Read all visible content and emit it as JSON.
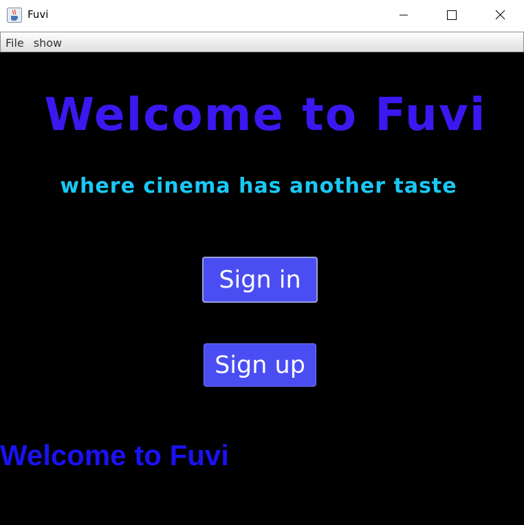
{
  "window": {
    "title": "Fuvi",
    "icons": {
      "app": "java-cup-icon",
      "minimize": "minimize-icon",
      "maximize": "maximize-icon",
      "close": "close-icon"
    }
  },
  "menubar": {
    "items": [
      {
        "label": "File"
      },
      {
        "label": "show"
      }
    ]
  },
  "main": {
    "headline": "Welcome to Fuvi",
    "subtitle": "where cinema has another taste",
    "signin_label": "Sign in",
    "signup_label": "Sign up",
    "footer_text": "Welcome to Fuvi"
  },
  "colors": {
    "background": "#000000",
    "headline": "#3a18f0",
    "subtitle": "#19c8f5",
    "button": "#4a4ef2",
    "button_text": "#ffffff",
    "footer_text": "#1a12f2"
  }
}
